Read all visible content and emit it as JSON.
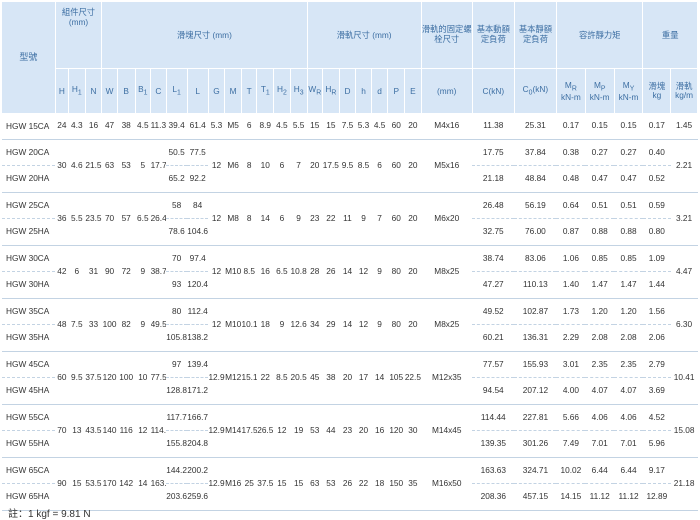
{
  "header": {
    "model": "型號",
    "assembly": "組件尺寸\n(mm)",
    "block_dims": "滑塊尺寸 (mm)",
    "rail_dims": "滑軌尺寸 (mm)",
    "rail_bolt": "滑軌的固定螺栓尺寸",
    "dynamic_load": "基本動額定負荷",
    "static_load": "基本靜額定負荷",
    "moment": "容許靜力矩",
    "weight": "重量",
    "cols": {
      "H": "H",
      "H1": "H1",
      "N": "N",
      "W": "W",
      "B": "B",
      "B1": "B1",
      "C": "C",
      "L1": "L1",
      "L": "L",
      "G": "G",
      "M": "M",
      "T": "T",
      "T1": "T1",
      "H2": "H2",
      "H3": "H3",
      "WR": "WR",
      "HR": "HR",
      "D": "D",
      "h": "h",
      "d": "d",
      "P": "P",
      "E": "E",
      "bolt_unit": "(mm)",
      "C_unit": "C(kN)",
      "C0_unit": "C0(kN)",
      "MR": "MR",
      "MP": "MP",
      "MY": "MY",
      "mom_unit": "kN-m",
      "block_w": "滑塊",
      "rail_w": "滑軌",
      "kg": "kg",
      "kgm": "kg/m"
    }
  },
  "groups": [
    {
      "models": [
        "HGW 15CA"
      ],
      "H": "24",
      "H1": "4.3",
      "N": "16",
      "W": "47",
      "B": "38",
      "B1": "4.5",
      "C": [
        "11.38"
      ],
      "L1": [
        "39.4"
      ],
      "L": [
        "61.4"
      ],
      "G": "5.3",
      "M": "M5",
      "T": "6",
      "T1": "",
      "H2": "8.9",
      "H3": "4.5",
      "WR": "15",
      "HR": "15",
      "D": "7.5",
      "h": "5.3",
      "d": "4.5",
      "P": "60",
      "E": "20",
      "bolt": "M4x16",
      "C0": [
        "25.31"
      ],
      "MR": [
        "0.17"
      ],
      "MP": [
        "0.15"
      ],
      "MY": [
        "0.15"
      ],
      "wb": [
        "0.17"
      ],
      "wr": "1.45",
      "T_merged": "",
      "T_extra": "",
      "b1": "5.5"
    },
    {
      "models": [
        "HGW 20CA",
        "HGW 20HA"
      ],
      "H": "30",
      "H1": "4.6",
      "N": "21.5",
      "W": "63",
      "B": "53",
      "B1": "5",
      "C": [
        "17.75",
        "21.18"
      ],
      "L1": [
        "50.5",
        "65.2"
      ],
      "L": [
        "77.5",
        "92.2"
      ],
      "G": "12",
      "M": "M6",
      "T": "8",
      "T1": "",
      "H2": "10",
      "H3": "6",
      "WR": "20",
      "HR": "17.5",
      "D": "9.5",
      "h": "8.5",
      "d": "6",
      "P": "60",
      "E": "20",
      "bolt": "M5x16",
      "C0": [
        "37.84",
        "48.84"
      ],
      "MR": [
        "0.38",
        "0.48"
      ],
      "MP": [
        "0.27",
        "0.47"
      ],
      "MY": [
        "0.27",
        "0.47"
      ],
      "wb": [
        "0.40",
        "0.52"
      ],
      "wr": "2.21",
      "b1": "7"
    },
    {
      "models": [
        "HGW 25CA",
        "HGW 25HA"
      ],
      "H": "36",
      "H1": "5.5",
      "N": "23.5",
      "W": "70",
      "B": "57",
      "B1": "6.5",
      "C": [
        "26.48",
        "32.75"
      ],
      "L1": [
        "58",
        "78.6"
      ],
      "L": [
        "84",
        "104.6"
      ],
      "G": "12",
      "M": "M8",
      "T": "8",
      "T1": "",
      "H2": "14",
      "H3": "6",
      "WR": "23",
      "HR": "22",
      "D": "11",
      "h": "9",
      "d": "7",
      "P": "60",
      "E": "20",
      "bolt": "M6x20",
      "C0": [
        "56.19",
        "76.00"
      ],
      "MR": [
        "0.64",
        "0.87"
      ],
      "MP": [
        "0.51",
        "0.88"
      ],
      "MY": [
        "0.51",
        "0.88"
      ],
      "wb": [
        "0.59",
        "0.80"
      ],
      "wr": "3.21",
      "b1": "9"
    },
    {
      "models": [
        "HGW 30CA",
        "HGW 30HA"
      ],
      "H": "42",
      "H1": "6",
      "N": "31",
      "W": "90",
      "B": "72",
      "B1": "9",
      "C": [
        "38.74",
        "47.27"
      ],
      "L1": [
        "70",
        "93"
      ],
      "L": [
        "97.4",
        "120.4"
      ],
      "G": "12",
      "M": "M10",
      "T": "8.5",
      "T1": "",
      "H2": "16",
      "H3": "6.5",
      "WR": "28",
      "HR": "26",
      "D": "14",
      "h": "12",
      "d": "9",
      "P": "80",
      "E": "20",
      "bolt": "M8x25",
      "C0": [
        "83.06",
        "110.13"
      ],
      "MR": [
        "1.06",
        "1.40"
      ],
      "MP": [
        "0.85",
        "1.47"
      ],
      "MY": [
        "0.85",
        "1.47"
      ],
      "wb": [
        "1.09",
        "1.44"
      ],
      "wr": "4.47",
      "b1": "10.8"
    },
    {
      "models": [
        "HGW 35CA",
        "HGW 35HA"
      ],
      "H": "48",
      "H1": "7.5",
      "N": "33",
      "W": "100",
      "B": "82",
      "B1": "9",
      "C": [
        "49.52",
        "60.21"
      ],
      "L1": [
        "80",
        "105.8"
      ],
      "L": [
        "112.4",
        "138.2"
      ],
      "G": "12",
      "M": "M10",
      "T": "10.1",
      "T1": "",
      "H2": "18",
      "H3": "9",
      "WR": "34",
      "HR": "29",
      "D": "14",
      "h": "12",
      "d": "9",
      "P": "80",
      "E": "20",
      "bolt": "M8x25",
      "C0": [
        "102.87",
        "136.31"
      ],
      "MR": [
        "1.73",
        "2.29"
      ],
      "MP": [
        "1.20",
        "2.08"
      ],
      "MY": [
        "1.20",
        "2.08"
      ],
      "wb": [
        "1.56",
        "2.06"
      ],
      "wr": "6.30",
      "b1": "12.6"
    },
    {
      "models": [
        "HGW 45CA",
        "HGW 45HA"
      ],
      "H": "60",
      "H1": "9.5",
      "N": "37.5",
      "W": "120",
      "B": "100",
      "B1": "10",
      "C": [
        "77.57",
        "94.54"
      ],
      "L1": [
        "97",
        "128.8"
      ],
      "L": [
        "139.4",
        "171.2"
      ],
      "G": "12.9",
      "M": "M12",
      "T": "15.1",
      "T1": "",
      "H2": "22",
      "H3": "8.5",
      "WR": "45",
      "HR": "38",
      "D": "20",
      "h": "17",
      "d": "14",
      "P": "105",
      "E": "22.5",
      "bolt": "M12x35",
      "C0": [
        "155.93",
        "207.12"
      ],
      "MR": [
        "3.01",
        "4.00"
      ],
      "MP": [
        "2.35",
        "4.07"
      ],
      "MY": [
        "2.35",
        "4.07"
      ],
      "wb": [
        "2.79",
        "3.69"
      ],
      "wr": "10.41",
      "b1": "20.5"
    },
    {
      "models": [
        "HGW 55CA",
        "HGW 55HA"
      ],
      "H": "70",
      "H1": "13",
      "N": "43.5",
      "W": "140",
      "B": "116",
      "B1": "12",
      "C": [
        "114.44",
        "139.35"
      ],
      "L1": [
        "117.7",
        "155.8"
      ],
      "L": [
        "166.7",
        "204.8"
      ],
      "G": "12.9",
      "M": "M14",
      "T": "17.5",
      "T1": "",
      "H2": "26.5",
      "H3": "12",
      "WR": "53",
      "HR": "44",
      "D": "23",
      "h": "20",
      "d": "16",
      "P": "120",
      "E": "30",
      "bolt": "M14x45",
      "C0": [
        "227.81",
        "301.26"
      ],
      "MR": [
        "5.66",
        "7.49"
      ],
      "MP": [
        "4.06",
        "7.01"
      ],
      "MY": [
        "4.06",
        "7.01"
      ],
      "wb": [
        "4.52",
        "5.96"
      ],
      "wr": "15.08",
      "b1": "19"
    },
    {
      "models": [
        "HGW 65CA",
        "HGW 65HA"
      ],
      "H": "90",
      "H1": "15",
      "N": "53.5",
      "W": "170",
      "B": "142",
      "B1": "14",
      "C": [
        "163.63",
        "208.36"
      ],
      "L1": [
        "144.2",
        "203.6"
      ],
      "L": [
        "200.2",
        "259.6"
      ],
      "G": "12.9",
      "M": "M16",
      "T": "25",
      "T1": "",
      "H2": "37.5",
      "H3": "15",
      "WR": "63",
      "HR": "53",
      "D": "26",
      "h": "22",
      "d": "18",
      "P": "150",
      "E": "35",
      "bolt": "M16x50",
      "C0": [
        "324.71",
        "457.15"
      ],
      "MR": [
        "10.02",
        "14.15"
      ],
      "MP": [
        "6.44",
        "11.12"
      ],
      "MY": [
        "6.44",
        "11.12"
      ],
      "wb": [
        "9.17",
        "12.89"
      ],
      "wr": "21.18",
      "b1": "15"
    }
  ],
  "note": "註：1 kgf = 9.81 N"
}
